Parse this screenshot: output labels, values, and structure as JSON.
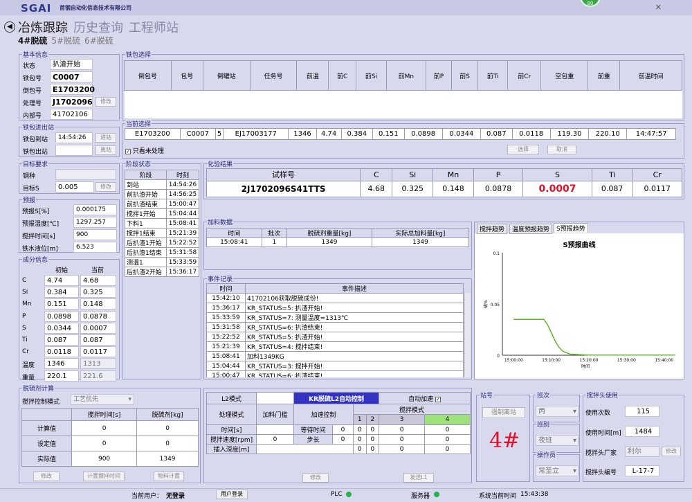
{
  "app": {
    "logo": "SGAI",
    "company": "首钢自动化信息技术有限公司",
    "badge": "80",
    "close": "✕"
  },
  "nav": {
    "tabs": [
      "冶炼跟踪",
      "历史查询",
      "工程师站"
    ],
    "sub": [
      "4#脱硫",
      "5#脱硫",
      "6#脱硫"
    ]
  },
  "basic": {
    "title": "基本信息",
    "rows": [
      {
        "label": "状态",
        "value": "扒渣开始"
      },
      {
        "label": "铁包号",
        "value": "C0007"
      },
      {
        "label": "倒包号",
        "value": "E1703200"
      },
      {
        "label": "处理号",
        "value": "J1702096"
      },
      {
        "label": "内部号",
        "value": "41702106"
      }
    ],
    "modify": "修改"
  },
  "ladle_io": {
    "title": "铁包进出站",
    "arrive_label": "铁包到站",
    "arrive_value": "14:54:26",
    "leave_label": "铁包出站",
    "leave_value": "",
    "enter_btn": "进站",
    "exit_btn": "离站"
  },
  "ladle_select": {
    "title": "铁包选择",
    "headers": [
      "倒包号",
      "包号",
      "倒罐站",
      "任务号",
      "前温",
      "前C",
      "前Si",
      "前Mn",
      "前P",
      "前S",
      "前Ti",
      "前Cr",
      "空包重",
      "前重",
      "前温时间"
    ]
  },
  "current": {
    "title": "当前选择",
    "values": [
      "E1703200",
      "C0007",
      "5",
      "EJ17003177",
      "1346",
      "4.74",
      "0.384",
      "0.151",
      "0.0898",
      "0.0344",
      "0.087",
      "0.0118",
      "119.30",
      "220.10",
      "14:47:57"
    ],
    "checkbox": "只看未处理",
    "select_btn": "选择",
    "cancel_btn": "取消"
  },
  "target": {
    "title": "目标要求",
    "steel_label": "钢种",
    "steel_value": "",
    "s_label": "目标S",
    "s_value": "0.005",
    "modify": "修改"
  },
  "forecast": {
    "title": "预报",
    "rows": [
      {
        "label": "预报S[%]",
        "value": "0.000175"
      },
      {
        "label": "预报温度[℃]",
        "value": "1297.257"
      },
      {
        "label": "搅拌时间[s]",
        "value": "900"
      },
      {
        "label": "铁水液位[m]",
        "value": "6.523"
      }
    ]
  },
  "composition": {
    "title": "成分信息",
    "h_init": "初始",
    "h_cur": "当前",
    "rows": [
      {
        "el": "C",
        "init": "4.74",
        "cur": "4.68"
      },
      {
        "el": "Si",
        "init": "0.384",
        "cur": "0.325"
      },
      {
        "el": "Mn",
        "init": "0.151",
        "cur": "0.148"
      },
      {
        "el": "P",
        "init": "0.0898",
        "cur": "0.0878"
      },
      {
        "el": "S",
        "init": "0.0344",
        "cur": "0.0007"
      },
      {
        "el": "Ti",
        "init": "0.087",
        "cur": "0.087"
      },
      {
        "el": "Cr",
        "init": "0.0118",
        "cur": "0.0117"
      },
      {
        "el": "温度",
        "init": "1346",
        "cur": "1313"
      },
      {
        "el": "重量",
        "init": "220.1",
        "cur": "221.6"
      }
    ]
  },
  "stage": {
    "title": "阶段状态",
    "h_stage": "阶段",
    "h_time": "时刻",
    "rows": [
      {
        "s": "到站",
        "t": "14:54:26"
      },
      {
        "s": "前扒渣开始",
        "t": "14:56:25"
      },
      {
        "s": "前扒渣结束",
        "t": "15:00:47"
      },
      {
        "s": "搅拌1开始",
        "t": "15:04:44"
      },
      {
        "s": "下料1",
        "t": "15:08:41"
      },
      {
        "s": "搅拌1结束",
        "t": "15:21:39"
      },
      {
        "s": "后扒渣1开始",
        "t": "15:22:52"
      },
      {
        "s": "后扒渣1结束",
        "t": "15:31:58"
      },
      {
        "s": "测温1",
        "t": "15:33:59"
      },
      {
        "s": "后扒渣2开始",
        "t": "15:36:17"
      }
    ]
  },
  "assay": {
    "title": "化验结果",
    "headers": [
      "试样号",
      "C",
      "Si",
      "Mn",
      "P",
      "S",
      "Ti",
      "Cr"
    ],
    "values": [
      "2J1702096S41TTS",
      "4.68",
      "0.325",
      "0.148",
      "0.0878",
      "0.0007",
      "0.087",
      "0.0117"
    ],
    "highlight_color": "#e0102a"
  },
  "feed": {
    "title": "加料数据",
    "headers": [
      "时间",
      "批次",
      "脱硫剂重量[kg]",
      "实际总加料量[kg]"
    ],
    "row": [
      "15:08:41",
      "1",
      "1349",
      "1349"
    ]
  },
  "events": {
    "title": "事件记录",
    "h_time": "时间",
    "h_desc": "事件描述",
    "rows": [
      {
        "t": "15:42:10",
        "d": "41702106获取脱硫成份!"
      },
      {
        "t": "15:36:17",
        "d": "KR_STATUS=5: 扒渣开始!"
      },
      {
        "t": "15:33:59",
        "d": "KR_STATUS=7: 测量温度=1313℃"
      },
      {
        "t": "15:31:58",
        "d": "KR_STATUS=6: 扒渣结束!"
      },
      {
        "t": "15:22:52",
        "d": "KR_STATUS=5: 扒渣开始!"
      },
      {
        "t": "15:21:39",
        "d": "KR_STATUS=4: 搅拌结束!"
      },
      {
        "t": "15:08:41",
        "d": "加料1349KG"
      },
      {
        "t": "15:04:44",
        "d": "KR_STATUS=3: 搅拌开始!"
      },
      {
        "t": "15:00:47",
        "d": "KR_STATUS=6: 扒渣结束!"
      }
    ]
  },
  "trend": {
    "tabs": [
      "搅拌趋势",
      "温度预报趋势",
      "S预报趋势"
    ]
  },
  "chart_data": {
    "type": "line",
    "title": "S预报曲线",
    "ylabel": "硫%",
    "xlabel": "时间",
    "x": [
      "15:00:00",
      "15:05:00",
      "15:08:00",
      "15:09:00",
      "15:10:00",
      "15:11:00",
      "15:12:00",
      "15:13:00",
      "15:15:00",
      "15:20:00",
      "15:30:00",
      "15:40:00",
      "15:43:00"
    ],
    "y_values": [
      0.035,
      0.035,
      0.035,
      0.03,
      0.022,
      0.014,
      0.008,
      0.004,
      0.001,
      0.0002,
      0.0002,
      0.0002,
      0.0002
    ],
    "xticks": [
      "15:00:00",
      "15:10:00",
      "15:20:00",
      "15:30:00",
      "15:40:00"
    ],
    "yticks": [
      "0",
      "0.05",
      "0.1"
    ],
    "ylim": [
      0,
      0.1
    ],
    "series_color": "#5cb82c",
    "grid": false
  },
  "desulf": {
    "title": "脱硫剂计算",
    "mode_label": "搅拌控制模式",
    "mode_value": "工艺优先",
    "h_time": "搅拌时间[s]",
    "h_agent": "脱硫剂[kg]",
    "rows": [
      {
        "label": "计算值",
        "time": "0",
        "agent": "0"
      },
      {
        "label": "设定值",
        "time": "0",
        "agent": "0"
      },
      {
        "label": "实际值",
        "time": "900",
        "agent": "1349"
      }
    ],
    "btn_modify": "修改",
    "btn_calc_time": "计置搅拌时间",
    "btn_calc_mat": "物料计置"
  },
  "l2": {
    "mode_label": "L2模式",
    "mode_value": "",
    "auto_label": "KR脱硫L2自动控制",
    "auto_accel": "自动加速",
    "checkmark": "✓",
    "proc_mode": "处理模式",
    "feed_gate": "加料门槛",
    "accel_ctrl": "加速控制",
    "stir_mode": "搅拌模式",
    "modes": [
      "1",
      "2",
      "3",
      "4"
    ],
    "time_label": "时间[s]",
    "wait_label": "等待时间",
    "wait_value": "0",
    "time_vals": [
      "0",
      "0",
      "0",
      "0"
    ],
    "speed_label": "搅拌速度[rpm]",
    "speed_value": "0",
    "step_label": "步长",
    "step_value": "0",
    "speed_vals": [
      "0",
      "0",
      "0",
      "0"
    ],
    "depth_label": "插入深度[m]",
    "depth_vals": [
      "0",
      "0",
      "0",
      "0"
    ],
    "btn_modify": "修改",
    "btn_send": "发送L1"
  },
  "station": {
    "title": "站号",
    "force_btn": "强制离站",
    "number": "4#"
  },
  "shift": {
    "title": "班次",
    "value": "丙",
    "group_title": "班别",
    "group_value": "夜班",
    "op_title": "操作员",
    "op_value": "常圣立"
  },
  "stirhead": {
    "title": "搅拌头使用",
    "uses_label": "使用次数",
    "uses_value": "115",
    "time_label": "使用时间[m]",
    "time_value": "1484",
    "maker_label": "搅拌头厂家",
    "maker_value": "利尔",
    "modify": "修改",
    "id_label": "搅拌头编号",
    "id_value": "L-17-7"
  },
  "status": {
    "user_label": "当前用户：",
    "user_value": "无登录",
    "login_btn": "用户登录",
    "plc": "PLC",
    "server": "服务器",
    "time_label": "系统当前时间",
    "time_value": "15:43:38"
  }
}
